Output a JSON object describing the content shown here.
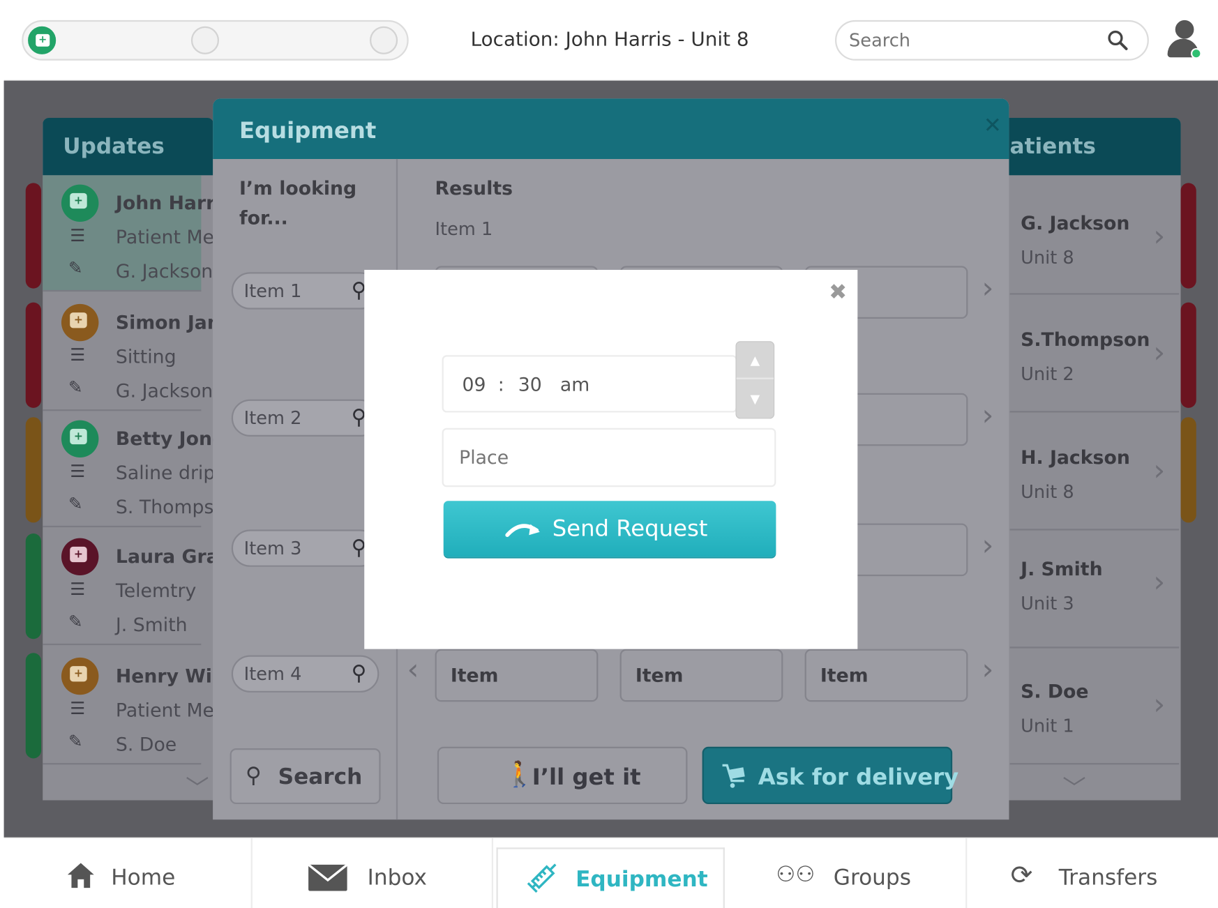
{
  "header": {
    "location": "Location: John Harris - Unit 8",
    "search_placeholder": "Search",
    "colors": {
      "status_online": "#2fbf71",
      "accent": "#1fb0bd"
    }
  },
  "updates": {
    "title": "Updates",
    "items": [
      {
        "name": "John Harris",
        "detail": "Patient Med",
        "assignee": "G. Jackson",
        "stripe": "#6b1420",
        "icon_color": "#1e8a5a"
      },
      {
        "name": "Simon Jam",
        "detail": "Sitting",
        "assignee": "G. Jackson",
        "stripe": "#6b1420",
        "icon_color": "#8a5a1e"
      },
      {
        "name": "Betty Jone",
        "detail": "Saline drip",
        "assignee": "S. Thompso",
        "stripe": "#7a5418",
        "icon_color": "#1e8a5a"
      },
      {
        "name": "Laura Gran",
        "detail": "Telemtry",
        "assignee": "J. Smith",
        "stripe": "#1b6b3c",
        "icon_color": "#5a1428"
      },
      {
        "name": "Henry Willi",
        "detail": "Patient Med",
        "assignee": "S. Doe",
        "stripe": "#1b6b3c",
        "icon_color": "#8a5a1e"
      }
    ]
  },
  "patients": {
    "title": "atients",
    "items": [
      {
        "name": "G. Jackson",
        "unit": "Unit 8",
        "stripe": "#6b1420"
      },
      {
        "name": "S.Thompson",
        "unit": "Unit 2",
        "stripe": "#6b1420"
      },
      {
        "name": "H. Jackson",
        "unit": "Unit 8",
        "stripe": "#7a5418"
      },
      {
        "name": "J. Smith",
        "unit": "Unit 3",
        "stripe": "#1b6b3c"
      },
      {
        "name": "S. Doe",
        "unit": "Unit 1",
        "stripe": "#1b6b3c"
      }
    ]
  },
  "equipment": {
    "title": "Equipment",
    "looking_for_line1": "I’m looking",
    "looking_for_line2": "for...",
    "search_items": [
      "Item 1",
      "Item 2",
      "Item 3",
      "Item 4"
    ],
    "search_button": "Search",
    "results_label": "Results",
    "results_first": "Item 1",
    "result_row": [
      "Item",
      "Item",
      "Item"
    ],
    "get_it_button": "I’ll get it",
    "delivery_button": "Ask for delivery"
  },
  "modal": {
    "hour": "09",
    "separator": ":",
    "minute": "30",
    "period": "am",
    "place_placeholder": "Place",
    "send_button": "Send Request"
  },
  "nav": {
    "items": [
      {
        "label": "Home",
        "icon": "home-icon"
      },
      {
        "label": "Inbox",
        "icon": "envelope-icon"
      },
      {
        "label": "Equipment",
        "icon": "syringe-icon",
        "active": true
      },
      {
        "label": "Groups",
        "icon": "groups-icon"
      },
      {
        "label": "Transfers",
        "icon": "transfers-icon"
      }
    ]
  }
}
